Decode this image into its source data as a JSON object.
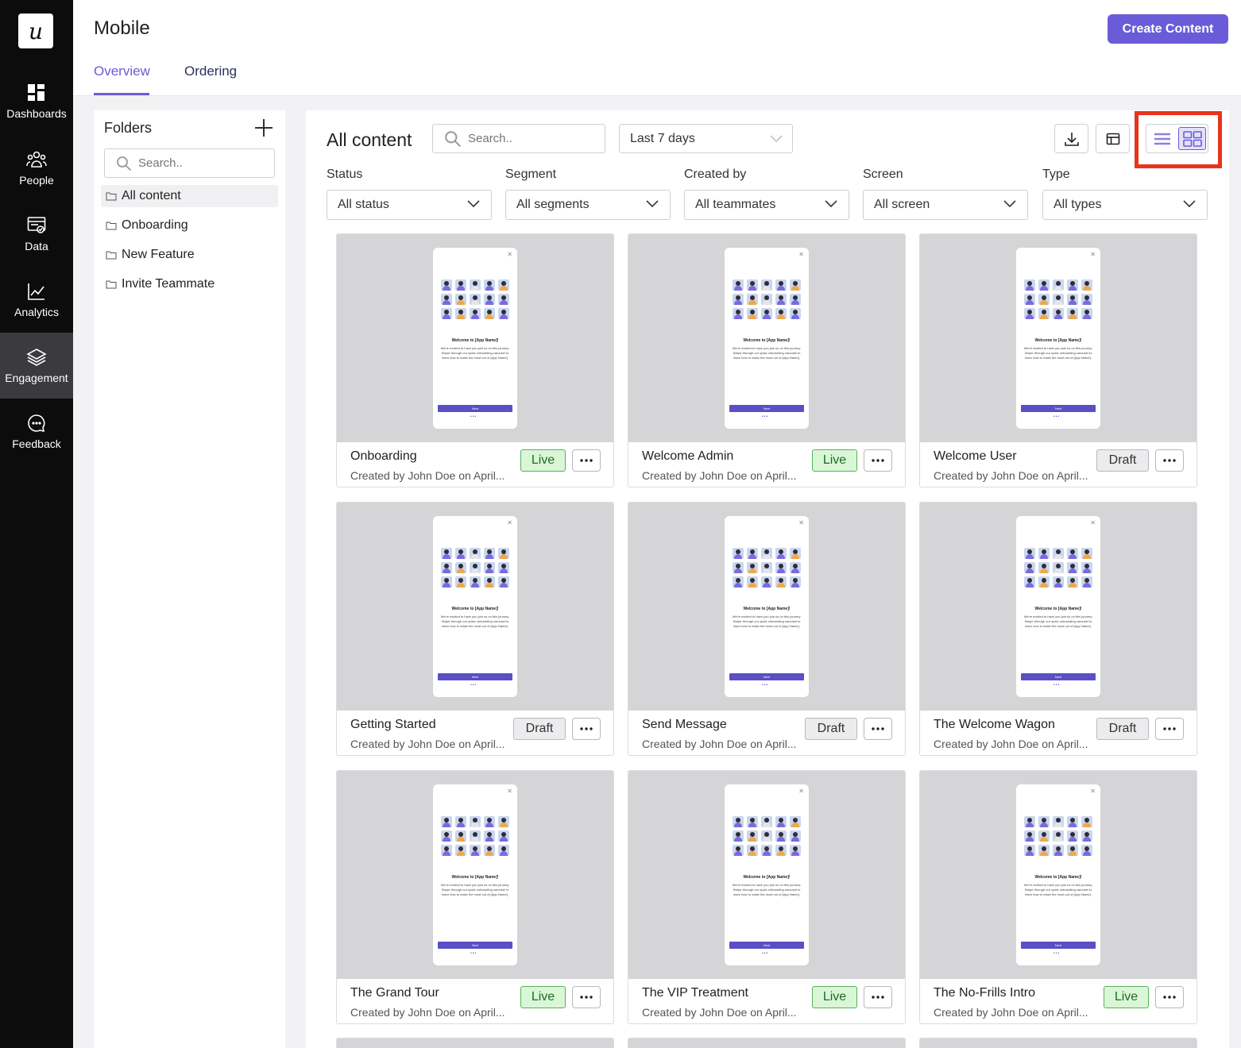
{
  "brand": {
    "logo_letter": "u",
    "accent": "#6a5cd8"
  },
  "sidebar": {
    "items": [
      {
        "label": "Dashboards",
        "icon": "dashboards-icon"
      },
      {
        "label": "People",
        "icon": "people-icon"
      },
      {
        "label": "Data",
        "icon": "data-icon"
      },
      {
        "label": "Analytics",
        "icon": "analytics-icon"
      },
      {
        "label": "Engagement",
        "icon": "engagement-icon",
        "active": true
      },
      {
        "label": "Feedback",
        "icon": "feedback-icon"
      }
    ]
  },
  "header": {
    "title": "Mobile",
    "create_label": "Create Content",
    "tabs": [
      {
        "label": "Overview",
        "active": true
      },
      {
        "label": "Ordering"
      }
    ]
  },
  "folders": {
    "title": "Folders",
    "search_placeholder": "Search..",
    "items": [
      {
        "label": "All content",
        "active": true
      },
      {
        "label": "Onboarding"
      },
      {
        "label": "New Feature"
      },
      {
        "label": "Invite Teammate"
      }
    ]
  },
  "main": {
    "title": "All content",
    "search_placeholder": "Search..",
    "date_range": "Last 7 days",
    "filters": [
      {
        "label": "Status",
        "value": "All status"
      },
      {
        "label": "Segment",
        "value": "All segments"
      },
      {
        "label": "Created by",
        "value": "All teammates"
      },
      {
        "label": "Screen",
        "value": "All screen"
      },
      {
        "label": "Type",
        "value": "All types"
      }
    ],
    "view_mode": "grid"
  },
  "preview": {
    "title": "Welcome to [App Name]!",
    "text": "We're excited to have you join us on this journey. Swipe through our quick onboarding carousel to learn how to make the most out of [App Name].",
    "button": "Next"
  },
  "cards": [
    {
      "name": "Onboarding",
      "meta": "Created by John Doe on April...",
      "status": "Live"
    },
    {
      "name": "Welcome Admin",
      "meta": "Created by John Doe on April...",
      "status": "Live"
    },
    {
      "name": "Welcome User",
      "meta": "Created by John Doe on April...",
      "status": "Draft"
    },
    {
      "name": "Getting Started",
      "meta": "Created by John Doe on April...",
      "status": "Draft"
    },
    {
      "name": "Send Message",
      "meta": "Created by John Doe on April...",
      "status": "Draft"
    },
    {
      "name": "The Welcome Wagon",
      "meta": "Created by John Doe on April...",
      "status": "Draft"
    },
    {
      "name": "The Grand Tour",
      "meta": "Created by John Doe on April...",
      "status": "Live"
    },
    {
      "name": "The VIP Treatment",
      "meta": "Created by John Doe on April...",
      "status": "Live"
    },
    {
      "name": "The No-Frills Intro",
      "meta": "Created by John Doe on April...",
      "status": "Live"
    }
  ]
}
